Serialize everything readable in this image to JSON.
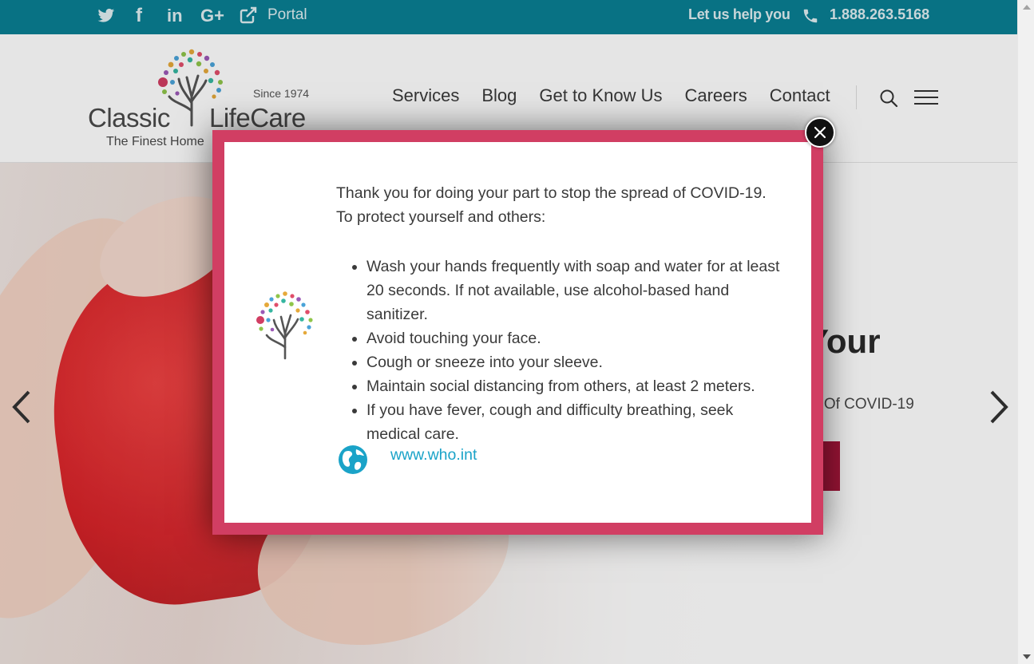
{
  "topbar": {
    "social_icons": [
      "twitter-icon",
      "facebook-icon",
      "linkedin-icon",
      "google-plus-icon",
      "external-link-icon"
    ],
    "facebook_glyph": "f",
    "linkedin_glyph": "in",
    "googleplus_glyph": "G+",
    "portal_label": "Portal",
    "help_label": "Let us help you",
    "phone": "1.888.263.5168",
    "background": "#0a7f93"
  },
  "logo": {
    "word1": "Classic",
    "word2": "LifeCare",
    "since": "Since 1974",
    "tagline": "The Finest Home"
  },
  "nav": {
    "items": [
      "Services",
      "Blog",
      "Get to Know Us",
      "Careers",
      "Contact"
    ]
  },
  "hero": {
    "title_partial": "Your",
    "subtitle_partial": "d Of COVID-19",
    "button_color": "#a8163a"
  },
  "modal": {
    "intro_line1": "Thank you for doing your part to stop the spread of COVID-19.",
    "intro_line2": "To protect yourself and others:",
    "tips": [
      "Wash your hands frequently with soap and water for at least 20 seconds. If not available, use alcohol-based hand sanitizer.",
      "Avoid touching your face.",
      "Cough or sneeze into your sleeve.",
      "Maintain social distancing from others, at least 2 meters.",
      "If you have fever, cough and difficulty breathing, seek medical care."
    ],
    "link_text": "www.who.int",
    "frame_color": "#d13e63",
    "link_color": "#1aa3c8"
  }
}
